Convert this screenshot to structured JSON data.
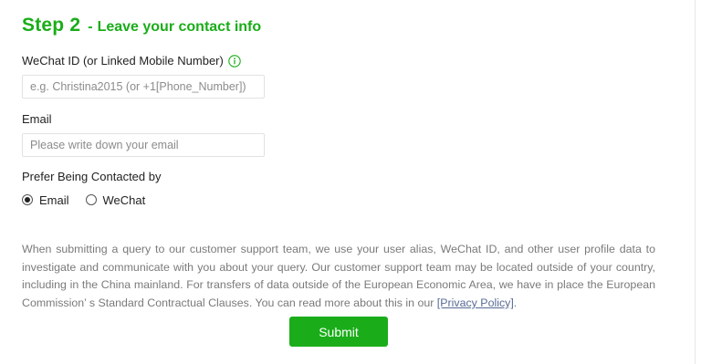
{
  "accent_color": "#1aad19",
  "link_color": "#576b95",
  "step": {
    "number": "Step 2",
    "dash": "-",
    "subtitle": "Leave your contact info"
  },
  "wechat_field": {
    "label": "WeChat ID (or Linked Mobile Number)",
    "icon": "info-icon",
    "value": "",
    "placeholder": "e.g. Christina2015 (or +1[Phone_Number])"
  },
  "email_field": {
    "label": "Email",
    "value": "",
    "placeholder": "Please write down your email"
  },
  "contact_preference": {
    "label": "Prefer Being Contacted by",
    "options": [
      {
        "label": "Email",
        "selected": true
      },
      {
        "label": "WeChat",
        "selected": false
      }
    ]
  },
  "notice": {
    "text": "When submitting a query to our customer support team, we use your user alias, WeChat ID, and other user profile data to investigate and communicate with you about your query. Our customer support team may be located outside of your country, including in the China mainland. For transfers of data outside of the European Economic Area, we have in place the European Commission’ s Standard Contractual Clauses. You can read more about this in our ",
    "link_text": "[Privacy Policy]",
    "end": "."
  },
  "submit_label": "Submit"
}
